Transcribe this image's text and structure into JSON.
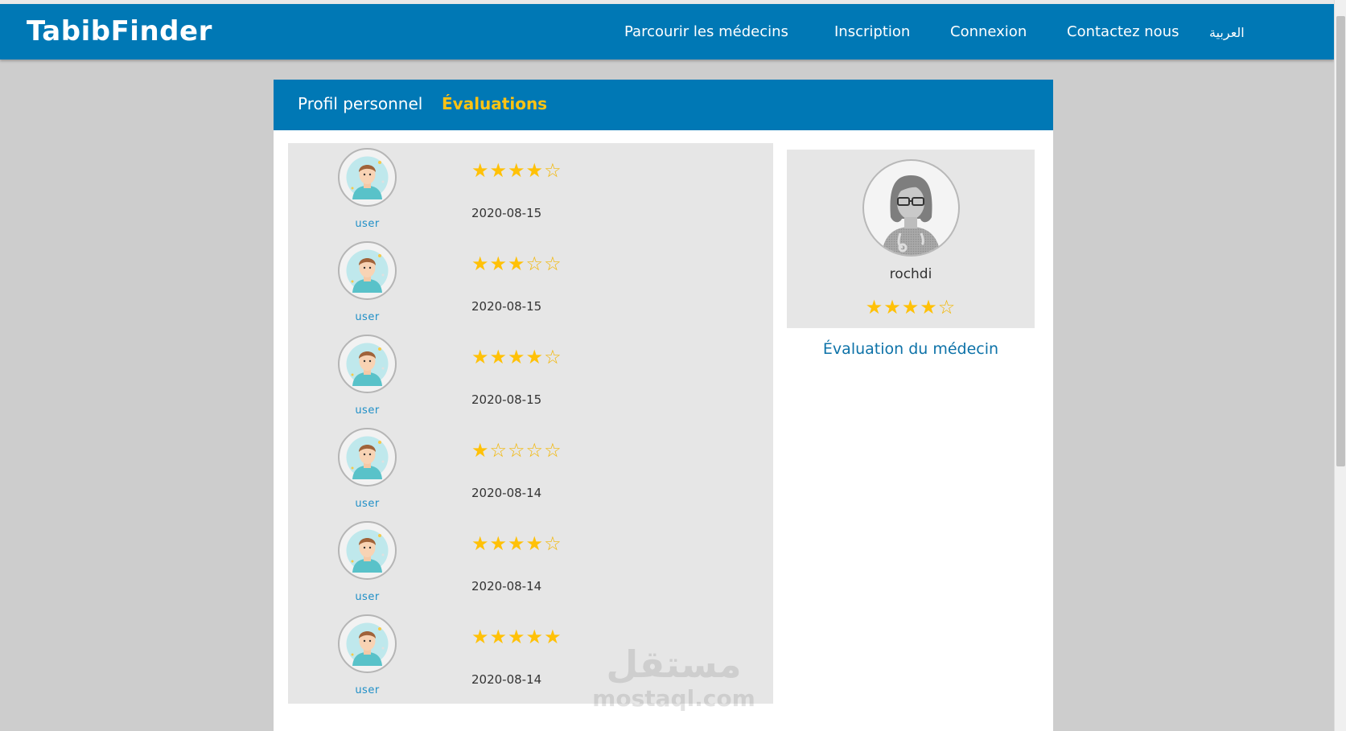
{
  "navbar": {
    "brand": "TabibFinder",
    "links": [
      {
        "label": "Parcourir les médecins"
      },
      {
        "label": "Inscription"
      },
      {
        "label": "Connexion"
      },
      {
        "label": "Contactez nous"
      },
      {
        "label": "العربية"
      }
    ]
  },
  "tabs": {
    "profile": "Profil personnel",
    "evaluations": "Évaluations"
  },
  "reviews": [
    {
      "user": "user",
      "rating": 4,
      "date": "2020-08-15"
    },
    {
      "user": "user",
      "rating": 3,
      "date": "2020-08-15"
    },
    {
      "user": "user",
      "rating": 4,
      "date": "2020-08-15"
    },
    {
      "user": "user",
      "rating": 1,
      "date": "2020-08-14"
    },
    {
      "user": "user",
      "rating": 4,
      "date": "2020-08-14"
    },
    {
      "user": "user",
      "rating": 5,
      "date": "2020-08-14"
    }
  ],
  "doctor": {
    "name": "rochdi",
    "rating": 4,
    "evaluation_link": "Évaluation du médecin"
  },
  "watermark": {
    "arabic": "مستقل",
    "latin": "mostaql.com"
  },
  "colors": {
    "primary": "#0078b5",
    "accent": "#ffc313",
    "star": "#ffc107"
  },
  "icons": {
    "user_avatar": "user-avatar-icon",
    "doctor_avatar": "doctor-avatar-icon",
    "star_filled": "star-filled-icon",
    "star_empty": "star-empty-icon"
  }
}
